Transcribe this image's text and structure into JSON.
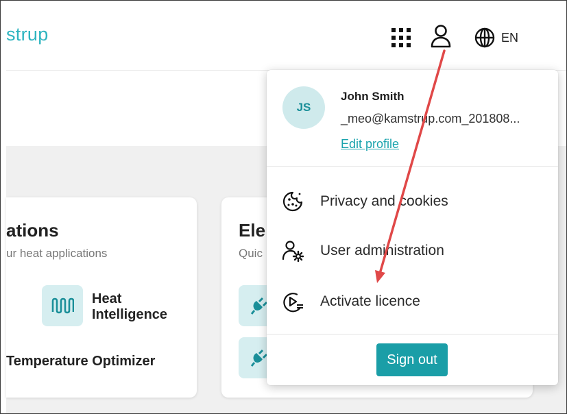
{
  "header": {
    "brand": "strup",
    "apps_icon": "grid-icon",
    "user_icon": "user-icon",
    "language": {
      "icon": "globe-icon",
      "label": "EN"
    }
  },
  "cards": {
    "heat": {
      "title": "ations",
      "subtitle": "ur heat applications",
      "apps": [
        {
          "name_line1": "Heat",
          "name_line2": "Intelligence",
          "icon": "waves-icon"
        },
        {
          "name": "Temperature Optimizer"
        }
      ]
    },
    "electric": {
      "title": "Ele",
      "subtitle": "Quic",
      "apps": [
        {
          "icon": "plug-icon"
        },
        {
          "icon": "plug-icon"
        }
      ]
    }
  },
  "user_menu": {
    "avatar_initials": "JS",
    "name": "John Smith",
    "email": "_meo@kamstrup.com_201808...",
    "edit_profile": "Edit profile",
    "items": [
      {
        "label": "Privacy and cookies",
        "icon": "cookie-icon"
      },
      {
        "label": "User administration",
        "icon": "user-gear-icon"
      },
      {
        "label": "Activate licence",
        "icon": "licence-play-icon"
      }
    ],
    "sign_out": "Sign out"
  },
  "colors": {
    "accent": "#1a9ea7",
    "brand": "#2fb5c0",
    "avatar_bg": "#cfeaec",
    "annotation_arrow": "#e04848"
  }
}
